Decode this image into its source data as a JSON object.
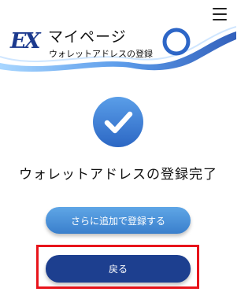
{
  "header": {
    "logo": "EX",
    "title": "マイページ",
    "subtitle": "ウォレットアドレスの登録",
    "menu_icon": "hamburger-menu-icon"
  },
  "main": {
    "status_icon": "check-circle-icon",
    "message": "ウォレットアドレスの登録完了",
    "add_button_label": "さらに追加で登録する",
    "back_button_label": "戻る"
  },
  "colors": {
    "brand_navy": "#1d3f8f",
    "accent_blue": "#3a7fcc",
    "highlight_red": "#e8141b"
  }
}
